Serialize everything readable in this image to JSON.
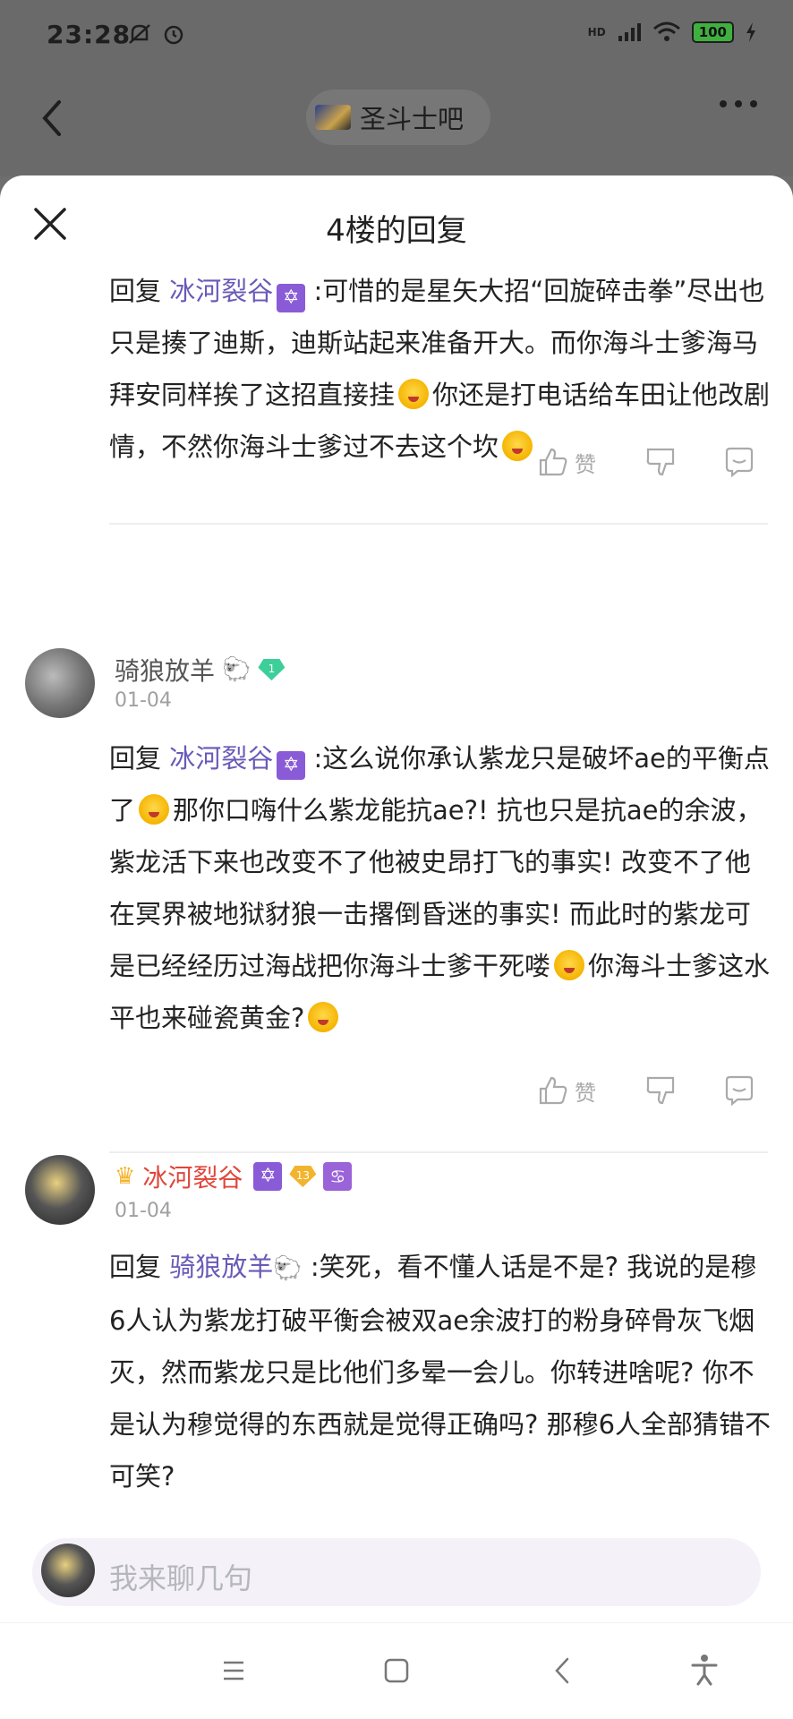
{
  "status_bar": {
    "time": "23:28",
    "battery": "100",
    "network": "HD"
  },
  "header": {
    "forum_name": "圣斗士吧"
  },
  "sheet": {
    "title": "4楼的回复"
  },
  "replies": [
    {
      "reply_prefix": "回复",
      "mention": "冰河裂谷",
      "text_1": ":可惜的是星矢大招“回旋碎击拳”尽出也只是揍了迪斯，迪斯站起来准备开大。而你海斗士爹海马拜安同样挨了这招直接挂",
      "text_2": "你还是打电话给车田让他改剧情，不然你海斗士爹过不去这个坎",
      "like_label": "赞"
    },
    {
      "user": "骑狼放羊",
      "level": "1",
      "date": "01-04",
      "reply_prefix": "回复",
      "mention": "冰河裂谷",
      "text_1": ":这么说你承认紫龙只是破坏ae的平衡点了",
      "text_2": "那你口嗨什么紫龙能抗ae?! 抗也只是抗ae的余波，紫龙活下来也改变不了他被史昂打飞的事实! 改变不了他在冥界被地狱豺狼一击撂倒昏迷的事实! 而此时的紫龙可是已经经历过海战把你海斗士爹干死喽",
      "text_3": "你海斗士爹这水平也来碰瓷黄金?",
      "like_label": "赞"
    },
    {
      "user": "冰河裂谷",
      "level": "13",
      "date": "01-04",
      "reply_prefix": "回复",
      "mention": "骑狼放羊",
      "text_1": ":笑死，看不懂人话是不是? 我说的是穆6人认为紫龙打破平衡会被双ae余波打的粉身碎骨灰飞烟灭，然而紫龙只是比他们多晕一会儿。你转进啥呢? 你不是认为穆觉得的东西就是觉得正确吗? 那穆6人全部猜错不可笑?"
    }
  ],
  "input": {
    "placeholder": "我来聊几句"
  },
  "colors": {
    "mention": "#6a5ab8",
    "highlight_name": "#e0463a",
    "overlay": "#6a6a6a"
  }
}
